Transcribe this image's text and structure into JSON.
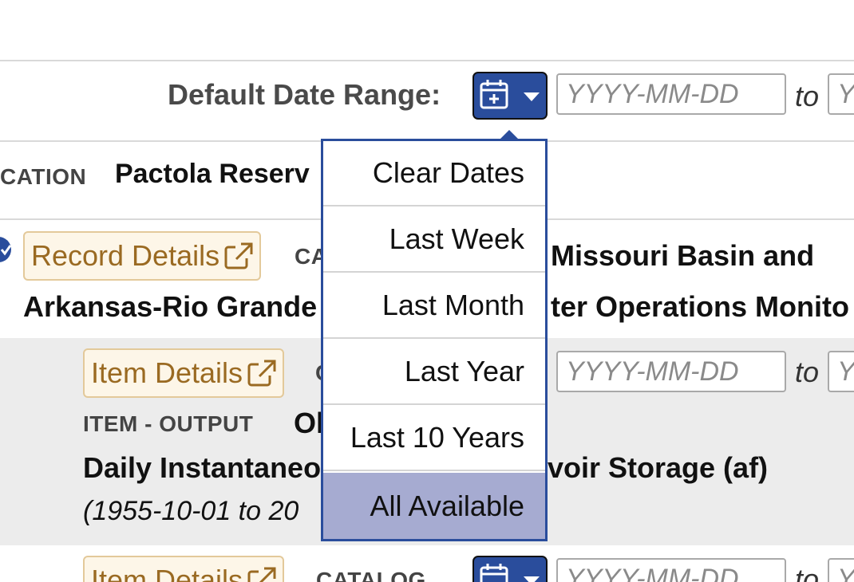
{
  "header": {
    "date_range_label": "Default Date Range:",
    "start_placeholder": "YYYY-MM-DD",
    "to_label": "to",
    "end_placeholder_partial": "Y"
  },
  "location": {
    "label": "CATION",
    "value": "Pactola Reserv"
  },
  "record": {
    "details_button": "Record Details",
    "catalog_label_partial": "CA",
    "title_line1_right": "Missouri Basin and",
    "title_line2_left": "Arkansas-Rio Grande",
    "title_line2_right": "ter Operations Monito"
  },
  "item1": {
    "details_button": "Item Details",
    "catalog_partial": "C",
    "start_placeholder": "YYYY-MM-DD",
    "to_label": "to",
    "end_placeholder_partial": "Y",
    "output_label": "ITEM - OUTPUT",
    "output_value_partial": "Ol",
    "name_left": "Daily Instantaneo",
    "name_right": "voir Storage (af)",
    "range_partial": "(1955-10-01 to 20"
  },
  "item2": {
    "details_button": "Item Details",
    "catalog_label": "CATALOG",
    "start_placeholder": "YYYY-MM-DD",
    "to_label": "to",
    "end_placeholder_partial": "Y"
  },
  "dropdown": {
    "items": [
      {
        "label": "Clear Dates"
      },
      {
        "label": "Last Week"
      },
      {
        "label": "Last Month"
      },
      {
        "label": "Last Year"
      },
      {
        "label": "Last 10 Years"
      },
      {
        "label": "All Available",
        "selected": true
      }
    ]
  },
  "colors": {
    "accent": "#2a4d9c",
    "detail_button_text": "#9a6a22",
    "dropdown_selected": "#a6abd1"
  },
  "icons": {
    "calendar": "calendar-plus-icon",
    "caret": "chevron-down-icon",
    "external": "external-link-icon",
    "check": "check-circle-icon"
  }
}
